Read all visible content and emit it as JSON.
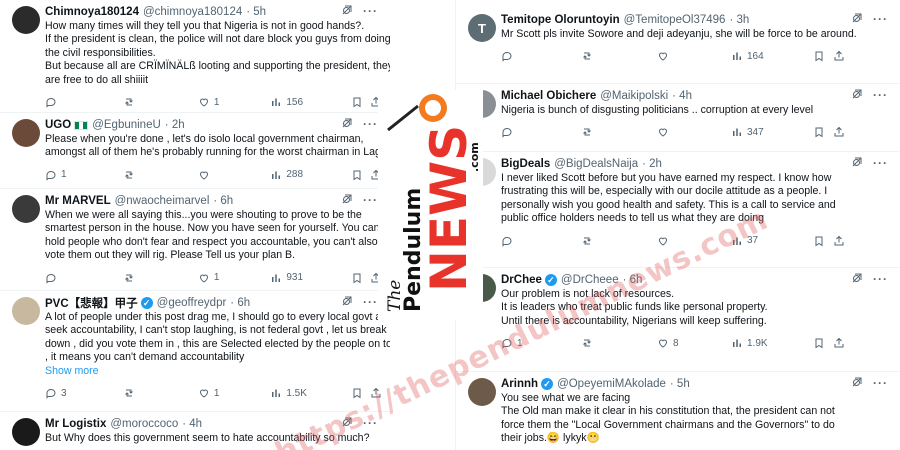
{
  "left_tweets": [
    {
      "name": "Chimnoya180124",
      "handle": "@chimnoya180124",
      "time": "· 5h",
      "avatar_color": "#2b2b2b",
      "lines": [
        "How many times will they tell you that Nigeria is not in good hands?.",
        "If the president is clean, the police will not dare block you guys from doing",
        "the civil responsibilities.",
        "But because all are CRÏMÏNÄLß looting and supporting the president, they",
        "are free to do all shiiiit"
      ],
      "reply": "",
      "rt": "",
      "like": "1",
      "views": "156"
    },
    {
      "name": "UGO",
      "handle": "@EgbunineU",
      "time": "· 2h",
      "flag": true,
      "avatar_color": "#6b4a3a",
      "lines": [
        "Please when you're done , let's do isolo local government chairman,",
        "amongst all of them he's probably running for the worst chairman in Lagos"
      ],
      "reply": "1",
      "rt": "",
      "like": "",
      "views": "288"
    },
    {
      "name": "Mr MARVEL",
      "handle": "@nwaocheimarvel",
      "time": "· 6h",
      "avatar_color": "#3a3a3a",
      "lines": [
        "When we were all saying this...you were shouting to prove to be the",
        "smartest person in the house. Now you have seen for yourself. You can't",
        "hold people who don't fear and respect you accountable, you can't also",
        "vote them out they will rig. Please Tell us your plan B."
      ],
      "reply": "",
      "rt": "",
      "like": "1",
      "views": "931"
    },
    {
      "name": "PVC【悲報】甲子",
      "handle": "@geoffreydpr",
      "time": "· 6h",
      "verified": true,
      "avatar_color": "#c9b8a0",
      "lines": [
        "A lot of people under this post drag me, I should go to every local govt and",
        "seek accountability, I can't stop laughing, is not federal govt , let us break it",
        "down , did you vote them in , this are Selected elected by the people on top",
        ", it means you can't demand accountability"
      ],
      "show_more": "Show more",
      "reply": "3",
      "rt": "",
      "like": "1",
      "views": "1.5K"
    },
    {
      "name": "Mr Logistix",
      "handle": "@moroccoco",
      "time": "· 4h",
      "avatar_color": "#1a1a1a",
      "lines": [
        "But Why does this government seem to hate accountability so much?"
      ],
      "reply": "",
      "rt": "",
      "like": "",
      "views": ""
    }
  ],
  "right_tweets": [
    {
      "name": "Temitope Oloruntoyin",
      "handle": "@TemitopeOl37496",
      "time": "· 3h",
      "avatar_letter": "T",
      "avatar_color": "#5d6d74",
      "lines": [
        "Mr Scott pls invite Sowore and deji adeyanju, she will be force to be around."
      ],
      "reply": "",
      "rt": "",
      "like": "",
      "views": "164"
    },
    {
      "name": "Michael Obichere",
      "handle": "@Maikipolski",
      "time": "· 4h",
      "avatar_color": "#8a8f96",
      "lines": [
        "Nigeria is bunch of disgusting politicians .. corruption at every level"
      ],
      "reply": "",
      "rt": "",
      "like": "",
      "views": "347"
    },
    {
      "name": "BigDeals",
      "handle": "@BigDealsNaija",
      "time": "· 2h",
      "avatar_color": "#d9d9d9",
      "lines": [
        "I never liked Scott before but you have earned my respect. I know how",
        "frustrating this will be, especially with our docile attitude as a people. I",
        "personally wish you good health and safety. This is a call to service and",
        "public office holders needs to tell us what they are doing"
      ],
      "reply": "",
      "rt": "",
      "like": "",
      "views": "37"
    },
    {
      "name": "DrChee",
      "handle": "@DrCheee",
      "time": "· 6h",
      "verified": true,
      "avatar_color": "#4a5a4a",
      "lines": [
        "Our problem is not lack of resources.",
        "It is leaders who treat public funds like personal property.",
        "Until there is accountability, Nigerians will keep suffering."
      ],
      "reply": "1",
      "rt": "",
      "like": "8",
      "views": "1.9K"
    },
    {
      "name": "Arinnh",
      "handle": "@OpeyemiMAkolade",
      "time": "· 5h",
      "verified": true,
      "avatar_color": "#6d5a48",
      "lines": [
        "You see what we are facing",
        "The Old man make it clear in his constitution that, the president can not",
        "force them the \"Local Government chairmans and the Governors\" to do",
        "their jobs.😄 lykyk😬"
      ],
      "reply": "",
      "rt": "",
      "like": "",
      "views": ""
    }
  ],
  "logo": {
    "the": "The",
    "pendulum": "Pendulum",
    "news": "NEWS",
    "com": ".com",
    "ball_color": "#f47a1f",
    "news_color": "#e8332a"
  },
  "watermark": "https://thependulumnews.com",
  "icons": [
    "grok-icon",
    "more-icon",
    "reply-icon",
    "retweet-icon",
    "like-icon",
    "views-icon",
    "bookmark-icon",
    "share-icon",
    "verified-icon"
  ]
}
